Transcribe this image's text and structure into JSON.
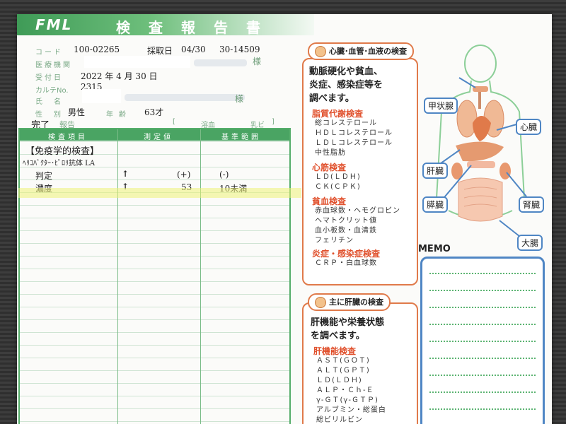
{
  "colors": {
    "header_green": "#4aa463",
    "accent_orange": "#e07a4a",
    "section_red": "#e0502c",
    "organ_blue": "#4f86c4"
  },
  "header": {
    "logo": "FML",
    "title": "検査報告書"
  },
  "patient": {
    "code_label": "コード",
    "code": "100-02265",
    "collect_label": "採取日",
    "collect_date": "04/30",
    "order_no": "30-14509",
    "facility_label": "医療機関",
    "honorific1": "様",
    "received_label": "受付日",
    "received": "2022 年  4 月 30 日",
    "chart_label": "カルテNo.",
    "chart_no": "2315",
    "name_label": "氏名",
    "honorific2": "様",
    "sex_label": "性別",
    "sex": "男性",
    "age_label": "年齢",
    "age": "63才"
  },
  "status": {
    "complete": "完了",
    "report": "報告",
    "hemolysis": "溶血",
    "chyle": "乳ビ"
  },
  "table": {
    "headers": [
      "検査項目",
      "測定値",
      "基準範囲"
    ],
    "section": "【免疫学的検査】",
    "test_name": "ﾍﾘｺﾊﾞｸﾀｰ･ﾋﾟﾛﾘ抗体 LA",
    "rows": [
      {
        "name": "判定",
        "flag": "↑",
        "value": "(+)",
        "range": "(-)"
      },
      {
        "name": "濃度",
        "flag": "↑",
        "value": "53",
        "range": "10未満"
      }
    ]
  },
  "panel1": {
    "title": "心臓･血管･血液の検査",
    "body": [
      "動脈硬化や貧血、",
      "炎症、感染症等を",
      "調べます。"
    ],
    "sections": [
      {
        "title": "脂質代謝検査",
        "items": [
          "総コレステロール",
          "ＨＤＬコレステロール",
          "ＬＤＬコレステロール",
          "中性脂肪"
        ]
      },
      {
        "title": "心筋検査",
        "items": [
          "ＬＤ(ＬＤＨ)",
          "ＣＫ(ＣＰＫ)"
        ]
      },
      {
        "title": "貧血検査",
        "items": [
          "赤血球数・ヘモグロビン",
          "ヘマトクリット値",
          "血小板数・血清鉄",
          "フェリチン"
        ]
      },
      {
        "title": "炎症・感染症検査",
        "items": [
          "ＣＲＰ・白血球数"
        ]
      }
    ]
  },
  "organs": {
    "thyroid": "甲状腺",
    "heart": "心臓",
    "liver": "肝臓",
    "pancreas": "膵臓",
    "kidney": "腎臓",
    "colon": "大腸"
  },
  "memo": {
    "label": "MEMO"
  },
  "panel2": {
    "title": "主に肝臓の検査",
    "body": [
      "肝機能や栄養状態",
      "を調べます。"
    ],
    "section_title": "肝機能検査",
    "items": [
      "ＡＳＴ(ＧＯＴ)",
      "ＡＬＴ(ＧＰＴ)",
      "ＬＤ(ＬＤＨ)",
      "ＡＬＰ・Ｃｈ-Ｅ",
      "γ-ＧＴ(γ-ＧＴＰ)",
      "アルブミン・総蛋白",
      "総ビリルビン"
    ]
  }
}
